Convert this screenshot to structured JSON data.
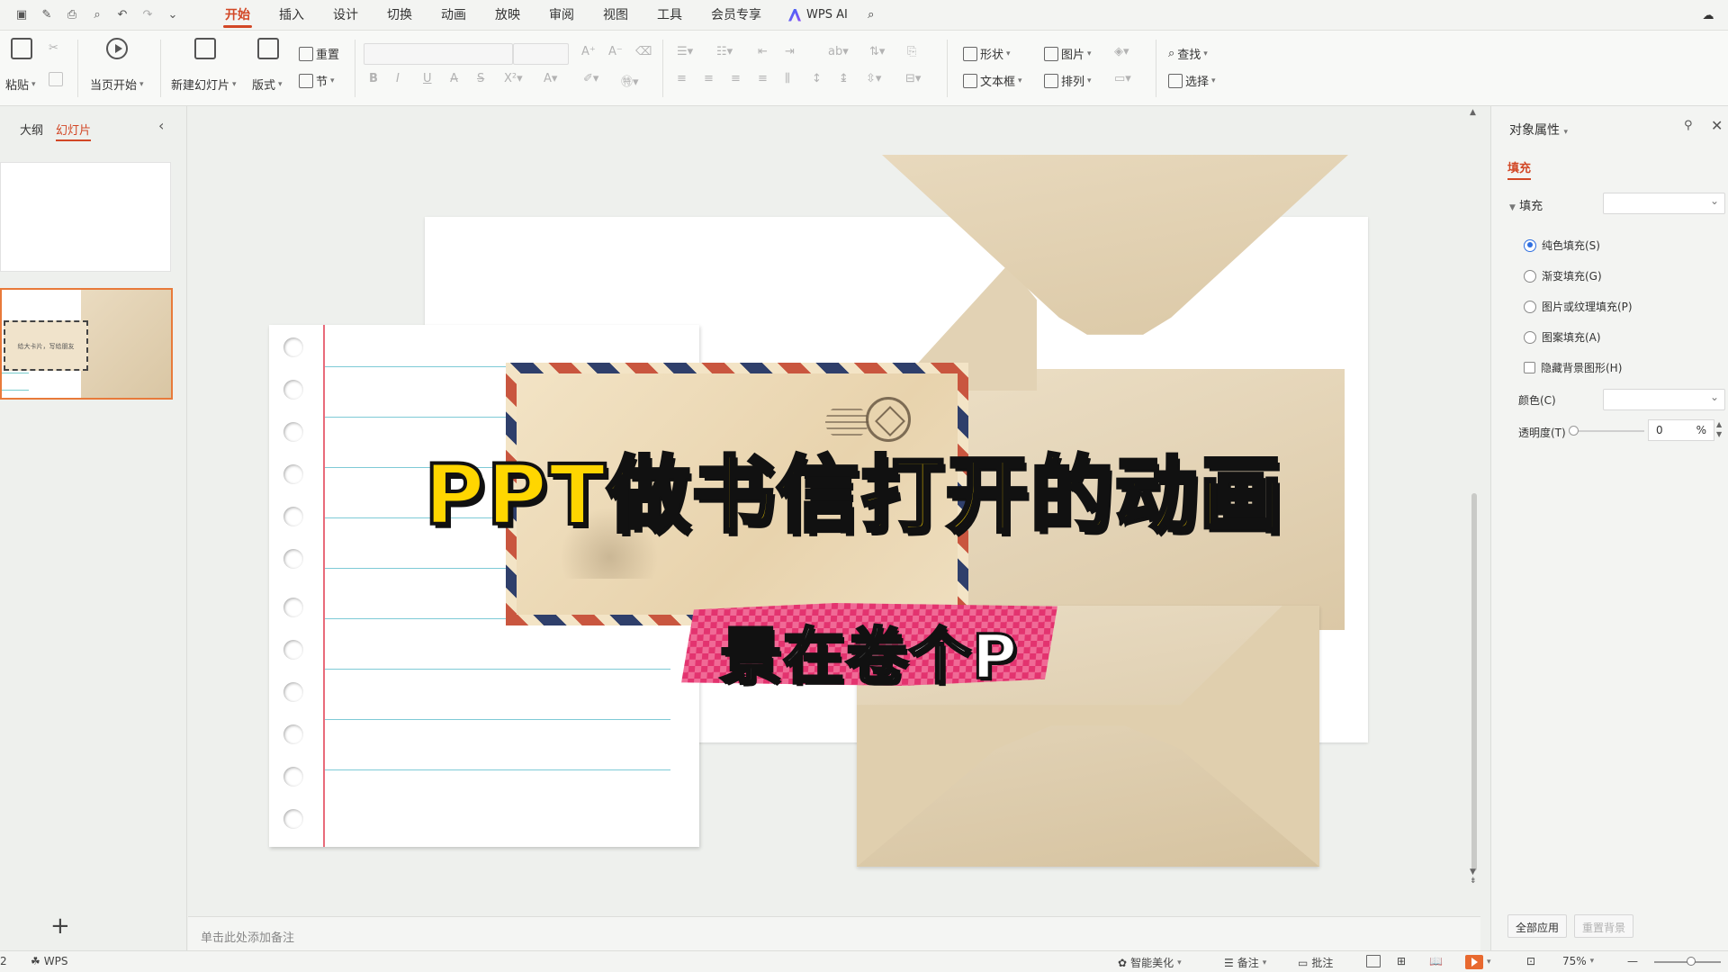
{
  "menu": {
    "items": [
      "开始",
      "插入",
      "设计",
      "切换",
      "动画",
      "放映",
      "审阅",
      "视图",
      "工具",
      "会员专享"
    ],
    "active": "开始",
    "wps_ai": "WPS AI"
  },
  "ribbon": {
    "paste": "粘贴",
    "start_from_current": "当页开始",
    "new_slide": "新建幻灯片",
    "layout": "版式",
    "reset": "重置",
    "section": "节",
    "shape": "形状",
    "picture": "图片",
    "textbox": "文本框",
    "arrange": "排列",
    "find": "查找",
    "select": "选择",
    "bold": "B",
    "italic": "I",
    "underline": "U",
    "strike": "S"
  },
  "left_panel": {
    "tab_outline": "大纲",
    "tab_slides": "幻灯片",
    "thumb_text": "给大卡片，写给朋友",
    "add": "+"
  },
  "slide": {
    "title": "PPT做书信打开的动画",
    "subtitle": "景在卷个P"
  },
  "notes": {
    "placeholder": "单击此处添加备注"
  },
  "right_panel": {
    "title": "对象属性",
    "tab_fill": "填充",
    "section_fill": "填充",
    "options": [
      {
        "label": "纯色填充(S)",
        "selected": true
      },
      {
        "label": "渐变填充(G)",
        "selected": false
      },
      {
        "label": "图片或纹理填充(P)",
        "selected": false
      },
      {
        "label": "图案填充(A)",
        "selected": false
      }
    ],
    "hide_bg": "隐藏背景图形(H)",
    "color_label": "颜色(C)",
    "transparency_label": "透明度(T)",
    "transparency_value": "0",
    "transparency_unit": "%",
    "apply_all": "全部应用",
    "reset_bg": "重置背景"
  },
  "status": {
    "page": "2",
    "app": "WPS",
    "smart_beautify": "智能美化",
    "notes": "备注",
    "comments": "批注",
    "zoom": "75%"
  },
  "colors": {
    "accent": "#d24726",
    "title_yellow": "#ffd600",
    "subtitle_pink": "#e3336f"
  }
}
